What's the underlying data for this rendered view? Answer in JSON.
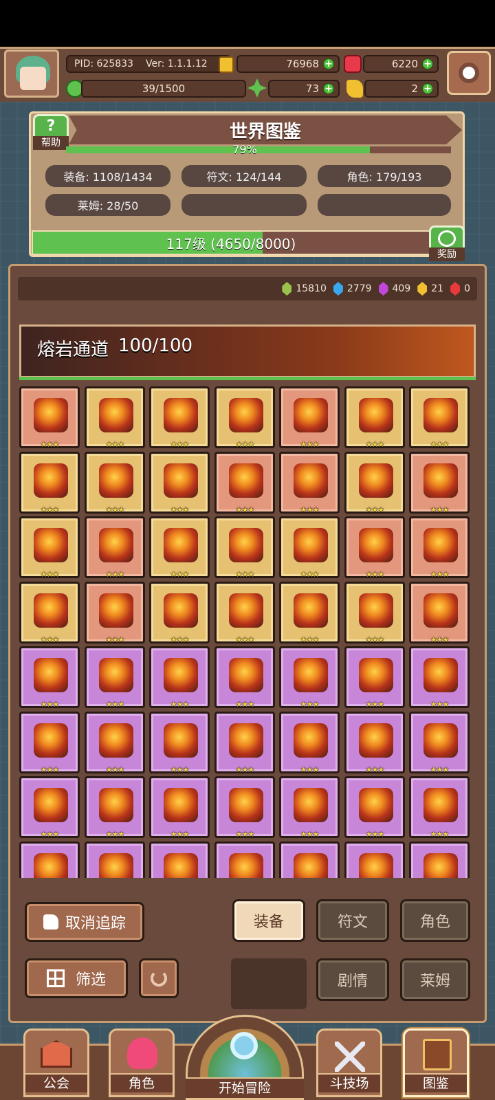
{
  "top": {
    "pid": "PID: 625833",
    "ver": "Ver: 1.1.1.12",
    "coins": "76968",
    "rubies": "6220",
    "energy": "39/1500",
    "clover": "73",
    "keys": "2"
  },
  "encyclopedia": {
    "title": "世界图鉴",
    "help_label": "帮助",
    "progress_pct": "79%",
    "progress_value": 0.79,
    "equip": "装备: 1108/1434",
    "rune": "符文: 124/144",
    "character": "角色: 179/193",
    "slime": "莱姆: 28/50",
    "level_text": "117级 (4650/8000)",
    "level_progress": 0.58,
    "reward_label": "奖励"
  },
  "gems": [
    {
      "value": "15810",
      "color": "#9bc24a"
    },
    {
      "value": "2779",
      "color": "#3aa8f0"
    },
    {
      "value": "409",
      "color": "#c048d8"
    },
    {
      "value": "21",
      "color": "#f0c030"
    },
    {
      "value": "0",
      "color": "#e83a3a"
    }
  ],
  "area": {
    "name": "熔岩通道",
    "count": "100/100"
  },
  "grid_rows": [
    [
      "red",
      "gold",
      "gold",
      "gold",
      "red",
      "gold",
      "gold"
    ],
    [
      "gold",
      "gold",
      "gold",
      "red",
      "red",
      "gold",
      "red"
    ],
    [
      "gold",
      "red",
      "gold",
      "gold",
      "gold",
      "red",
      "red"
    ],
    [
      "gold",
      "red",
      "gold",
      "gold",
      "gold",
      "gold",
      "red"
    ],
    [
      "purple",
      "purple",
      "purple",
      "purple",
      "purple",
      "purple",
      "purple"
    ],
    [
      "purple",
      "purple",
      "purple",
      "purple",
      "purple",
      "purple",
      "purple"
    ],
    [
      "purple",
      "purple",
      "purple",
      "purple",
      "purple",
      "purple",
      "purple"
    ],
    [
      "purple",
      "purple",
      "purple",
      "purple",
      "purple",
      "purple",
      "purple"
    ]
  ],
  "stars": "★★★",
  "controls": {
    "untrack": "取消追踪",
    "filter": "筛选",
    "tab_equip": "装备",
    "tab_rune": "符文",
    "tab_character": "角色",
    "tab_story": "剧情",
    "tab_slime": "莱姆"
  },
  "nav": {
    "guild": "公会",
    "character": "角色",
    "adventure": "开始冒险",
    "arena": "斗技场",
    "codex": "图鉴"
  }
}
